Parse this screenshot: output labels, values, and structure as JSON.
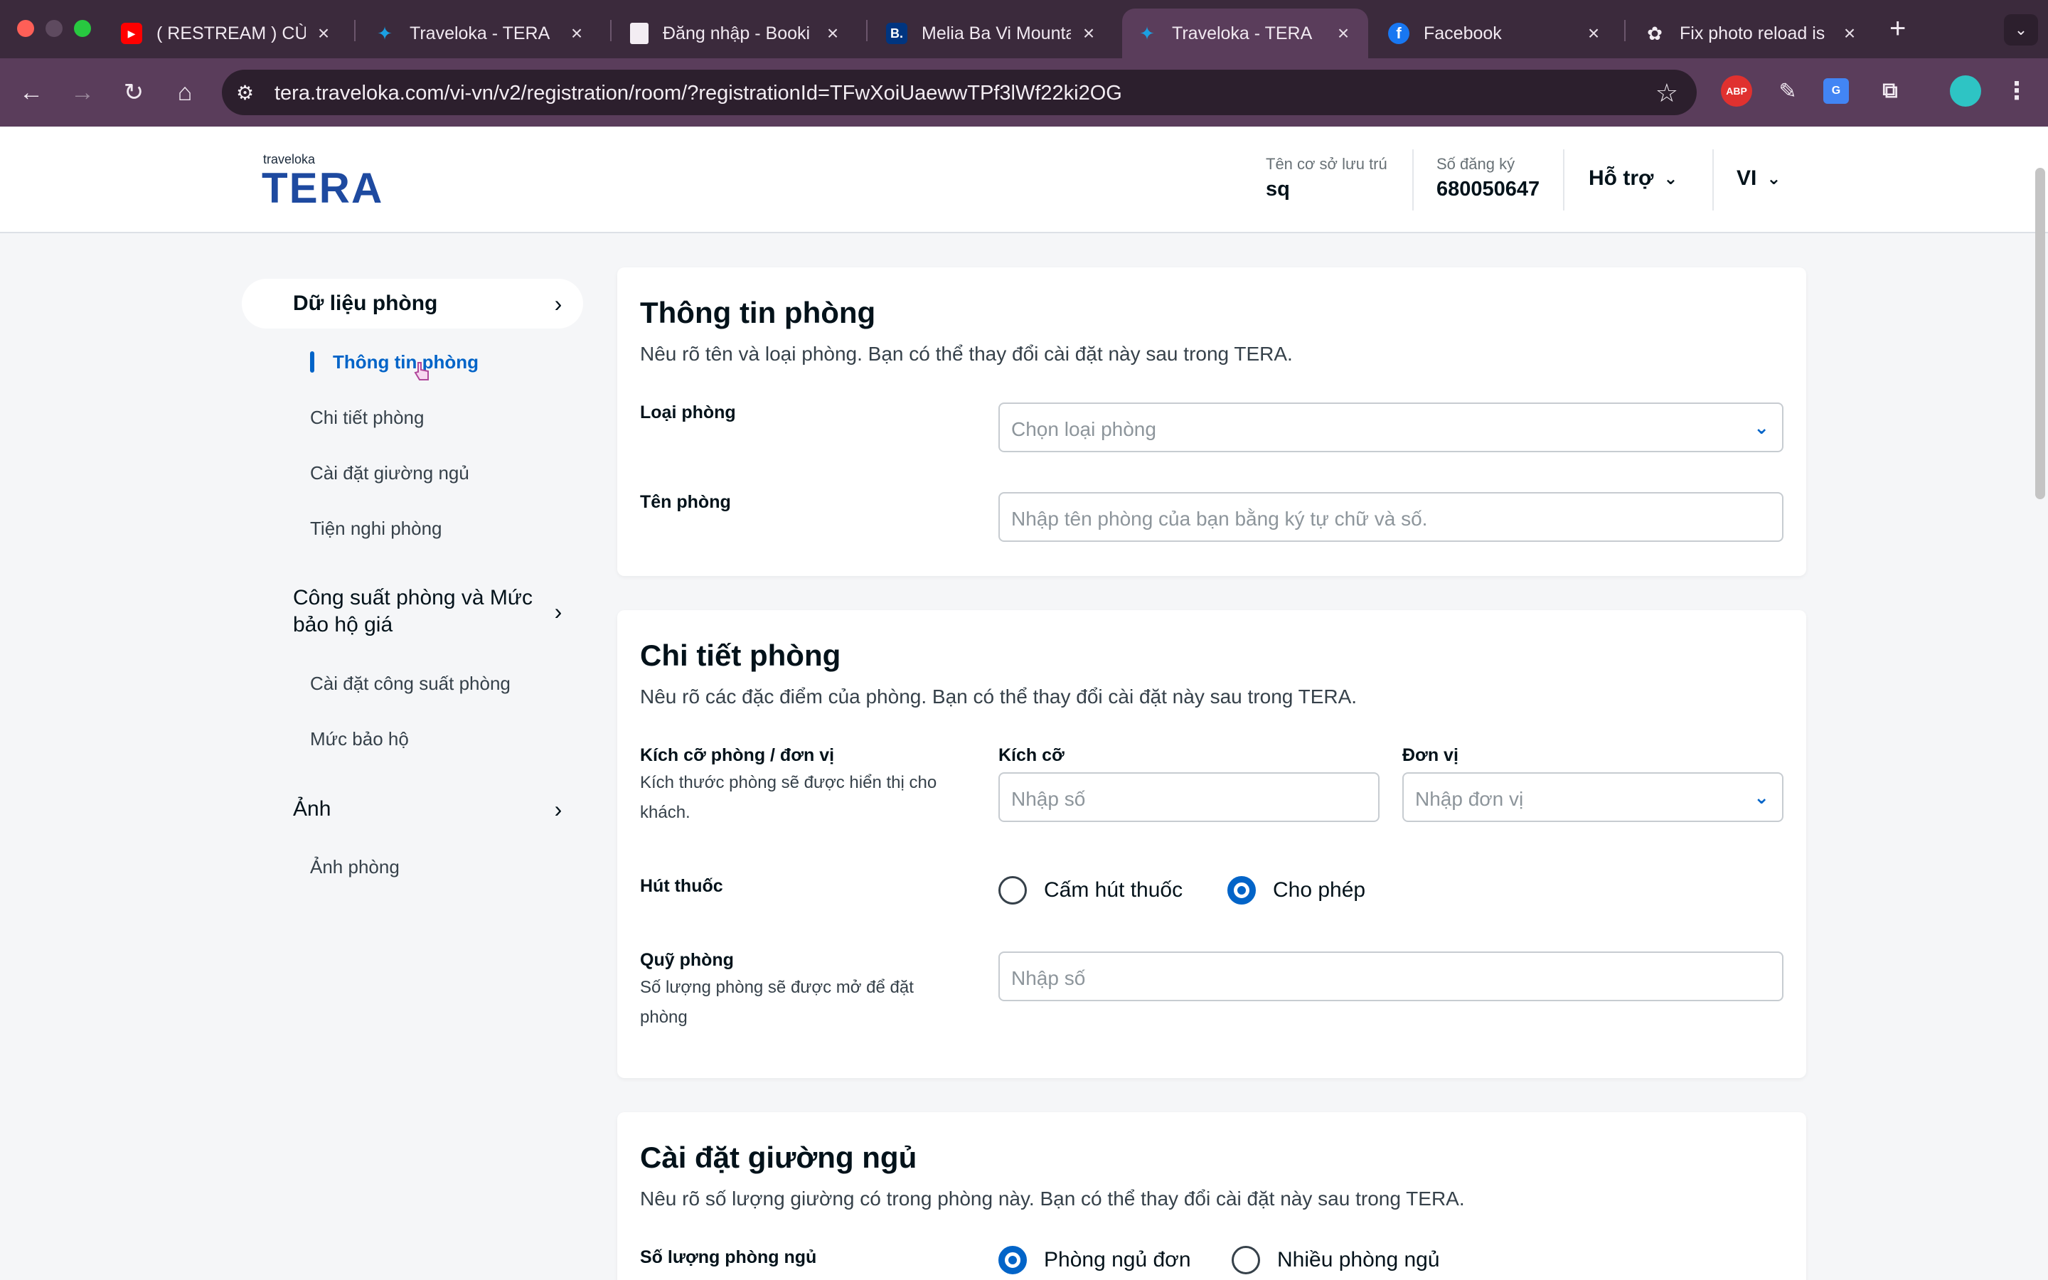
{
  "browser": {
    "tabs": [
      {
        "title": "( RESTREAM ) CÙN",
        "icon": "youtube-icon"
      },
      {
        "title": "Traveloka - TERA",
        "icon": "traveloka-icon"
      },
      {
        "title": "Đăng nhập - Booki",
        "icon": "document-icon"
      },
      {
        "title": "Melia Ba Vi Mounta",
        "icon": "booking-icon",
        "badge": "B."
      },
      {
        "title": "Traveloka - TERA",
        "icon": "traveloka-icon",
        "active": true
      },
      {
        "title": "Facebook",
        "icon": "facebook-icon",
        "badge": "f"
      },
      {
        "title": "Fix photo reload is",
        "icon": "openai-icon"
      }
    ],
    "url": "tera.traveloka.com/vi-vn/v2/registration/room/?registrationId=TFwXoiUaewwTPf3lWf22ki2OG",
    "ext_abp": "ABP",
    "ext_translate": "G"
  },
  "header": {
    "logo_small": "traveloka",
    "logo_big": "TERA",
    "property_label": "Tên cơ sở lưu trú",
    "property_value": "sq",
    "reg_label": "Số đăng ký",
    "reg_value": "680050647",
    "support": "Hỗ trợ",
    "lang": "VI"
  },
  "sidebar": {
    "sections": [
      {
        "title": "Dữ liệu phòng",
        "items": [
          "Thông tin phòng",
          "Chi tiết phòng",
          "Cài đặt giường ngủ",
          "Tiện nghi phòng"
        ]
      },
      {
        "title_line1": "Công suất phòng và Mức",
        "title_line2": "bảo hộ giá",
        "items": [
          "Cài đặt công suất phòng",
          "Mức bảo hộ"
        ]
      },
      {
        "title": "Ảnh",
        "items": [
          "Ảnh phòng"
        ]
      }
    ]
  },
  "room_info": {
    "title": "Thông tin phòng",
    "subtitle": "Nêu rõ tên và loại phòng. Bạn có thể thay đổi cài đặt này sau trong TERA.",
    "type_label": "Loại phòng",
    "type_placeholder": "Chọn loại phòng",
    "name_label": "Tên phòng",
    "name_placeholder": "Nhập tên phòng của bạn bằng ký tự chữ và số."
  },
  "room_detail": {
    "title": "Chi tiết phòng",
    "subtitle": "Nêu rõ các đặc điểm của phòng. Bạn có thể thay đổi cài đặt này sau trong TERA.",
    "size_label": "Kích cỡ phòng / đơn vị",
    "size_help_1": "Kích thước phòng sẽ được hiển thị cho",
    "size_help_2": "khách.",
    "size_col": "Kích cỡ",
    "size_placeholder": "Nhập số",
    "unit_col": "Đơn vị",
    "unit_placeholder": "Nhập đơn vị",
    "smoking_label": "Hút thuốc",
    "smoking_options": [
      "Cấm hút thuốc",
      "Cho phép"
    ],
    "smoking_selected": "Cho phép",
    "quota_label": "Quỹ phòng",
    "quota_help_1": "Số lượng phòng sẽ được mở để đặt",
    "quota_help_2": "phòng",
    "quota_placeholder": "Nhập số"
  },
  "bed_settings": {
    "title": "Cài đặt giường ngủ",
    "subtitle": "Nêu rõ số lượng giường có trong phòng này. Bạn có thể thay đổi cài đặt này sau trong TERA.",
    "bedroom_label": "Số lượng phòng ngủ",
    "bedroom_options": [
      "Phòng ngủ đơn",
      "Nhiều phòng ngủ"
    ],
    "bedroom_selected": "Phòng ngủ đơn"
  }
}
